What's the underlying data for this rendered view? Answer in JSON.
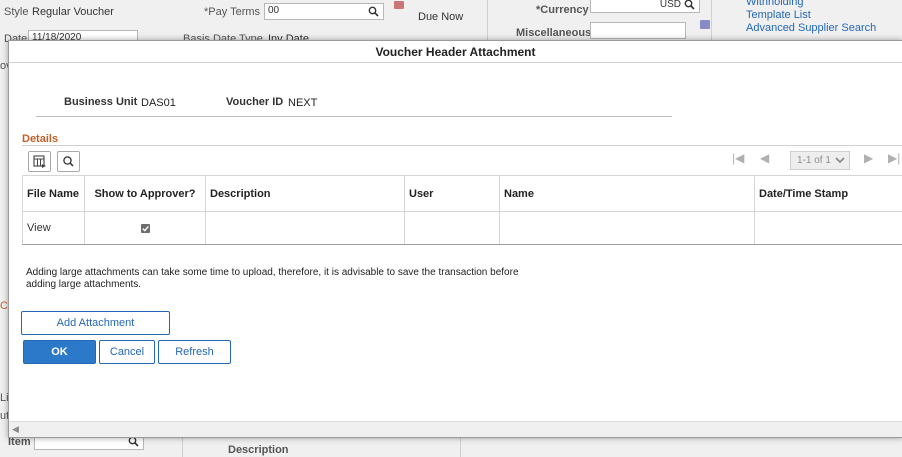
{
  "background": {
    "style_label": "Style",
    "style_value": "Regular Voucher",
    "pay_terms_label": "*Pay Terms",
    "pay_terms_value": "00",
    "due_now": "Due Now",
    "currency_label": "*Currency",
    "currency_value": "USD",
    "withholding_link": "Withholding",
    "template_list_link": "Template List",
    "advanced_supplier_search_link": "Advanced Supplier Search",
    "date_label": "Date",
    "date_value": "11/18/2020",
    "basis_date_type_label": "Basis Date Type",
    "basis_date_type_value": "Inv Date",
    "miscellaneous_label": "Miscellaneous",
    "item_label": "Item",
    "description_label": "Description"
  },
  "modal": {
    "title": "Voucher Header Attachment",
    "business_unit_label": "Business Unit",
    "business_unit_value": "DAS01",
    "voucher_id_label": "Voucher ID",
    "voucher_id_value": "NEXT",
    "section_title": "Details",
    "pager_text": "1-1 of 1",
    "table": {
      "headers": [
        "File Name",
        "Show to Approver?",
        "Description",
        "User",
        "Name",
        "Date/Time Stamp"
      ],
      "rows": [
        {
          "file_name": "View",
          "show_to_approver": true,
          "description": "",
          "user": "",
          "name": "",
          "datetime": ""
        }
      ]
    },
    "note": "Adding large attachments can take some time to upload, therefore, it is advisable to save the transaction before adding large attachments.",
    "add_attachment_label": "Add Attachment",
    "ok_label": "OK",
    "cancel_label": "Cancel",
    "refresh_label": "Refresh"
  }
}
